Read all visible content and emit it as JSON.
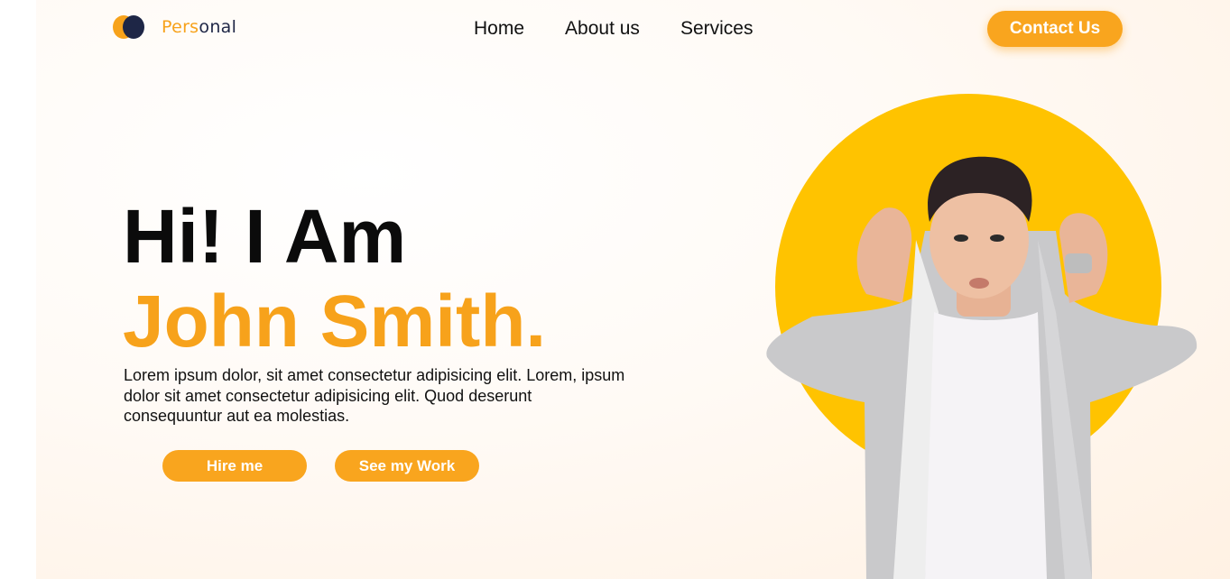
{
  "logo": {
    "part1": "Pers",
    "part2": "onal"
  },
  "nav": {
    "items": [
      "Home",
      "About us",
      "Services"
    ],
    "contact_label": "Contact Us"
  },
  "hero": {
    "greeting": "Hi! I Am",
    "name": "John Smith.",
    "description": "Lorem ipsum dolor, sit amet consectetur adipisicing elit. Lorem, ipsum dolor sit amet consectetur adipisicing elit. Quod deserunt consequuntur aut ea molestias.",
    "hire_label": "Hire me",
    "work_label": "See my Work"
  },
  "colors": {
    "accent": "#f9a51e",
    "circle": "#ffc300",
    "dark": "#1e2646"
  }
}
